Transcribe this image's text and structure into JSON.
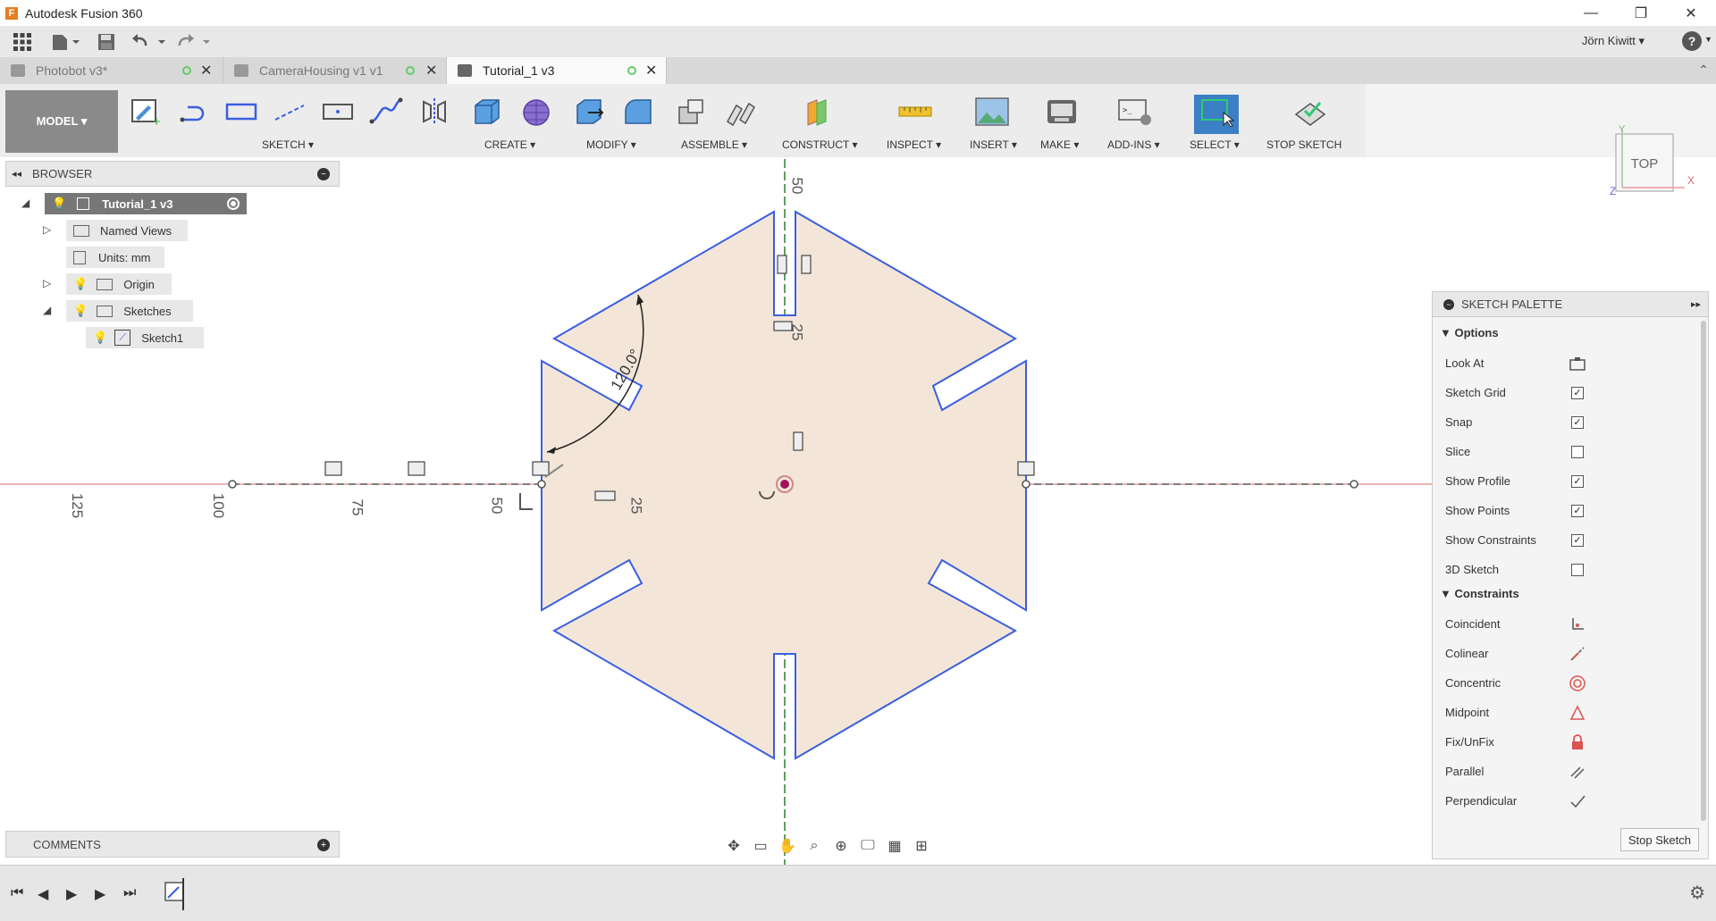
{
  "app": {
    "title": "Autodesk Fusion 360",
    "logo_letter": "F",
    "window_buttons": [
      "—",
      "❐",
      "✕"
    ]
  },
  "quickaccess": {
    "user": "Jörn Kiwitt ▾",
    "help": "?"
  },
  "tabs": [
    {
      "label": "Photobot v3*"
    },
    {
      "label": "CameraHousing v1 v1"
    },
    {
      "label": "Tutorial_1 v3",
      "active": true
    }
  ],
  "toolbar": {
    "workspace": "MODEL ▾",
    "groups": [
      {
        "label": "SKETCH ▾"
      },
      {
        "label": "CREATE ▾"
      },
      {
        "label": "MODIFY ▾"
      },
      {
        "label": "ASSEMBLE ▾"
      },
      {
        "label": "CONSTRUCT ▾"
      },
      {
        "label": "INSPECT ▾"
      },
      {
        "label": "INSERT ▾"
      },
      {
        "label": "MAKE ▾"
      },
      {
        "label": "ADD-INS ▾"
      },
      {
        "label": "SELECT ▾"
      },
      {
        "label": "STOP SKETCH"
      }
    ]
  },
  "browser": {
    "title": "BROWSER",
    "items": [
      {
        "label": "Tutorial_1 v3"
      },
      {
        "label": "Named Views"
      },
      {
        "label": "Units: mm"
      },
      {
        "label": "Origin"
      },
      {
        "label": "Sketches"
      },
      {
        "label": "Sketch1"
      }
    ]
  },
  "viewcube": {
    "face": "TOP",
    "axis_y": "Y",
    "axis_x": "X",
    "axis_z": "Z"
  },
  "canvas": {
    "axis_labels": [
      "125",
      "100",
      "75",
      "50",
      "25",
      "50",
      "25"
    ],
    "angle_dimension": "120.0°"
  },
  "palette": {
    "title": "SKETCH PALETTE",
    "options_title": "Options",
    "options": [
      {
        "label": "Look At",
        "type": "button",
        "checked": null
      },
      {
        "label": "Sketch Grid",
        "type": "checkbox",
        "checked": true
      },
      {
        "label": "Snap",
        "type": "checkbox",
        "checked": true
      },
      {
        "label": "Slice",
        "type": "checkbox",
        "checked": false
      },
      {
        "label": "Show Profile",
        "type": "checkbox",
        "checked": true
      },
      {
        "label": "Show Points",
        "type": "checkbox",
        "checked": true
      },
      {
        "label": "Show Constraints",
        "type": "checkbox",
        "checked": true
      },
      {
        "label": "3D Sketch",
        "type": "checkbox",
        "checked": false
      }
    ],
    "constraints_title": "Constraints",
    "constraints": [
      {
        "label": "Coincident",
        "icon": "coincident-icon"
      },
      {
        "label": "Colinear",
        "icon": "colinear-icon"
      },
      {
        "label": "Concentric",
        "icon": "concentric-icon"
      },
      {
        "label": "Midpoint",
        "icon": "midpoint-icon"
      },
      {
        "label": "Fix/UnFix",
        "icon": "fix-icon"
      },
      {
        "label": "Parallel",
        "icon": "parallel-icon"
      },
      {
        "label": "Perpendicular",
        "icon": "perpendicular-icon"
      }
    ],
    "stop_button": "Stop Sketch"
  },
  "comments": {
    "title": "COMMENTS"
  },
  "colors": {
    "sketch_line": "#3a5fe0",
    "profile_fill": "#f3e6d8",
    "x_axis": "#d46a6a",
    "y_axis": "#2e7d32",
    "select_active": "#3b7fc4",
    "constraint_red": "#d9534f"
  }
}
